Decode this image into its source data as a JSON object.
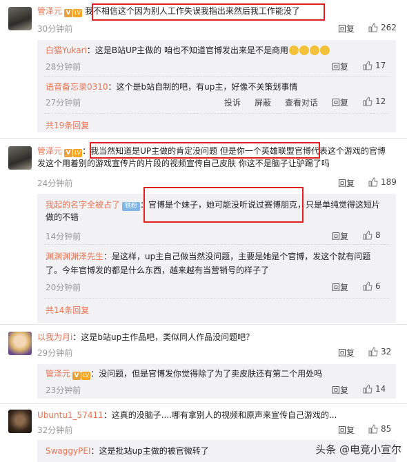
{
  "actions": {
    "reply": "回复",
    "report": "投诉",
    "block": "屏蔽",
    "view_convo": "查看对话"
  },
  "comments": [
    {
      "name": "管泽元",
      "text": "我不相信这个因为别人工作失误我指出来然后我工作能没了",
      "time": "30分钟前",
      "likes": "262",
      "replies": [
        {
          "name": "白猫Yukari",
          "text": "：这是B站UP主做的 咱也不知道官博发出来是不是商用",
          "time": "28分钟前",
          "likes": "17"
        },
        {
          "name": "语音备忘录0310",
          "text": "：这个是b站自制的吧，有up主，好像不关策划事情",
          "time": "27分钟前",
          "likes": "12"
        }
      ],
      "more": "共19条回复"
    },
    {
      "name": "管泽元",
      "text1": "：我当然知道是UP主做的肯定没问题 但是你一个英雄联盟官博代表这个游戏的官博",
      "text2": "发这个用着别的游戏宣传片的片段的视频宣传自己皮肤 你这不是脑子让驴踢了吗",
      "time": "24分钟前",
      "likes": "189",
      "replies": [
        {
          "name": "我起的名字全被占了",
          "fan": "铁粉",
          "text1": "：官博是个妹子，她可能没听说过赛博朋克，只是单纯觉得这短片",
          "text2": "做的不错",
          "time": "14分钟前",
          "likes": "8"
        },
        {
          "name": "渊渊渊渊泽先生",
          "text1": "：是这样，up主自己做当然没问题，主要是她是个官博，发这个就有问题",
          "text2": "了。今年官博发的都是什么东西，越来越有当营销号的样子了",
          "time": "20分钟前",
          "likes": "6"
        }
      ],
      "more": "共14条回复"
    },
    {
      "name": "以我为月i",
      "text": "：这是b站up主作品吧，类似同人作品没问题吧？",
      "time": "29分钟前",
      "likes": "32",
      "replies": [
        {
          "name": "管泽元",
          "text": "：没问题，但是官博发你觉得除了为了卖皮肤还有第二个用处吗",
          "time": "23分钟前",
          "likes": "14"
        }
      ]
    },
    {
      "name": "Ubuntu1_57411",
      "text": "：这真的没脑子....哪有拿别人的视频和原声来宣传自己游戏的...",
      "time": "32分钟前",
      "likes": "85",
      "replies": [
        {
          "name": "SwaggyPEI",
          "text": "：这是批站up主做的被官微转了"
        }
      ]
    }
  ],
  "watermark": "头条 @电竞小宣尔",
  "colors": {
    "name": "#eb7350",
    "highlight": "#e02020",
    "sub_bg": "#f2f2f5"
  }
}
